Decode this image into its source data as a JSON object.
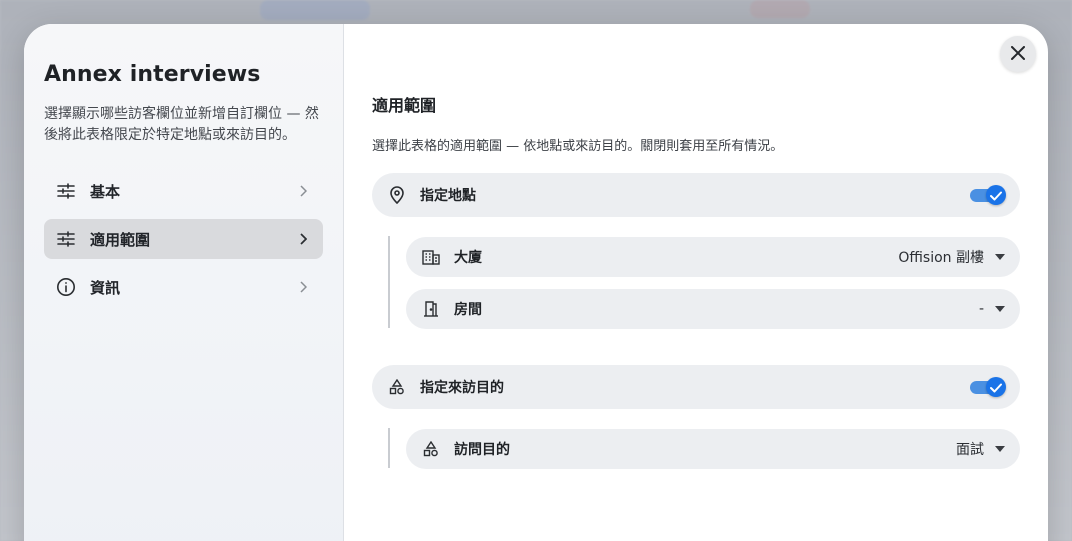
{
  "sidebar": {
    "title": "Annex interviews",
    "description": "選擇顯示哪些訪客欄位並新增自訂欄位 — 然後將此表格限定於特定地點或來訪目的。",
    "items": [
      {
        "label": "基本",
        "icon": "sliders-icon",
        "active": false
      },
      {
        "label": "適用範圍",
        "icon": "sliders-icon",
        "active": true
      },
      {
        "label": "資訊",
        "icon": "info-icon",
        "active": false
      }
    ]
  },
  "main": {
    "close_icon": "close-icon",
    "section_title": "適用範圍",
    "section_description": "選擇此表格的適用範圍 — 依地點或來訪目的。關閉則套用至所有情況。",
    "location_toggle": {
      "label": "指定地點",
      "icon": "location-pin-icon",
      "enabled": true
    },
    "building_select": {
      "label": "大廈",
      "icon": "building-icon",
      "value": "Offision 副樓"
    },
    "room_select": {
      "label": "房間",
      "icon": "door-icon",
      "value": "-"
    },
    "purpose_toggle": {
      "label": "指定來訪目的",
      "icon": "shapes-icon",
      "enabled": true
    },
    "purpose_select": {
      "label": "訪問目的",
      "icon": "shapes-icon",
      "value": "面試"
    }
  },
  "colors": {
    "accent": "#1a73e8",
    "row_bg": "#eceef1",
    "active_nav_bg": "#d9dadd"
  }
}
